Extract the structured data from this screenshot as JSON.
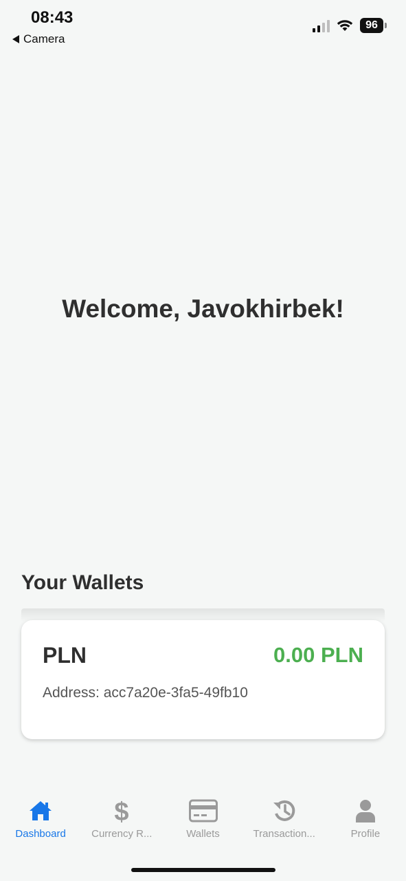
{
  "status_bar": {
    "time": "08:43",
    "back_label": "Camera",
    "battery": "96"
  },
  "dashboard": {
    "welcome": "Welcome, Javokhirbek!",
    "wallets_title": "Your Wallets"
  },
  "wallets": [
    {
      "currency": "PLN",
      "balance": "0.00 PLN",
      "address": "Address: acc7a20e-3fa5-49fb10"
    }
  ],
  "tabbar": {
    "items": [
      {
        "label": "Dashboard",
        "icon": "home-icon",
        "active": true
      },
      {
        "label": "Currency R...",
        "icon": "dollar-icon",
        "active": false
      },
      {
        "label": "Wallets",
        "icon": "card-icon",
        "active": false
      },
      {
        "label": "Transaction...",
        "icon": "history-icon",
        "active": false
      },
      {
        "label": "Profile",
        "icon": "person-icon",
        "active": false
      }
    ]
  },
  "colors": {
    "accent": "#1877e8",
    "balance": "#4caf50",
    "inactive": "#9a9a9a",
    "background": "#f5f7f6"
  }
}
